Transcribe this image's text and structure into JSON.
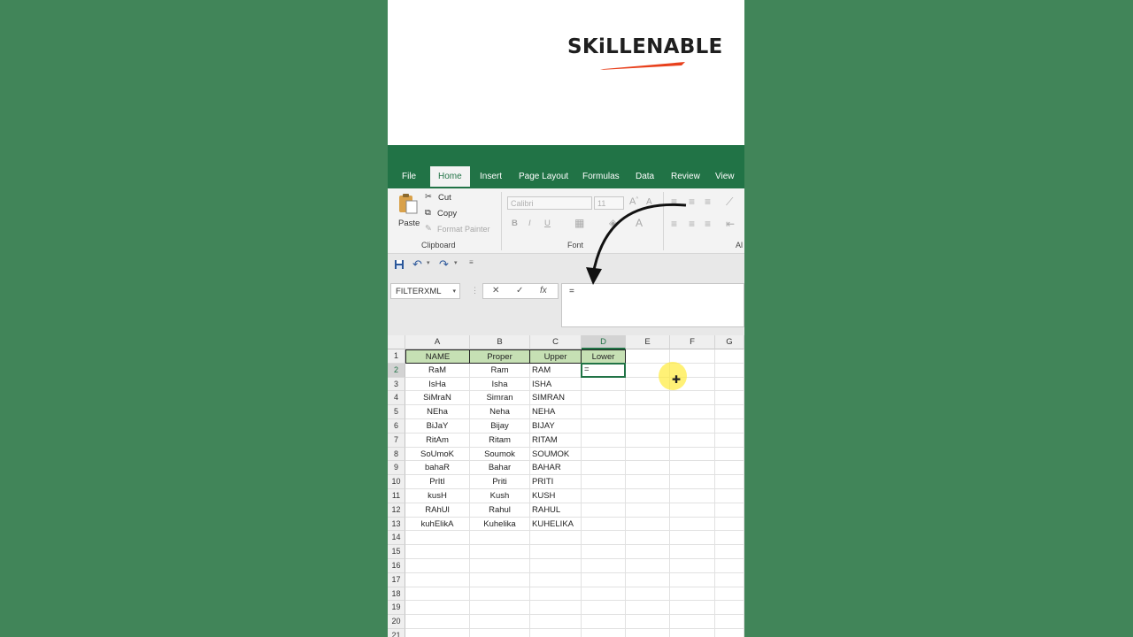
{
  "brand": {
    "logo_text": "SKiLLENABLE",
    "accent_color": "#e8401c"
  },
  "ribbon_tabs": [
    "File",
    "Home",
    "Insert",
    "Page Layout",
    "Formulas",
    "Data",
    "Review",
    "View"
  ],
  "active_tab": "Home",
  "clipboard": {
    "paste": "Paste",
    "cut": "Cut",
    "copy": "Copy",
    "format_painter": "Format Painter",
    "group_label": "Clipboard"
  },
  "font_group": {
    "font_name": "Calibri",
    "font_size": "11",
    "bold": "B",
    "italic": "I",
    "underline": "U",
    "group_label": "Font"
  },
  "alignment_group": {
    "group_label": "Al"
  },
  "formula_bar": {
    "name_box": "FILTERXML",
    "cancel": "✕",
    "enter": "✓",
    "fx": "fx",
    "content": "="
  },
  "columns": [
    "A",
    "B",
    "C",
    "D",
    "E",
    "F",
    "G"
  ],
  "selected_column": "D",
  "selected_row": "2",
  "header_row": [
    "NAME",
    "Proper",
    "Upper",
    "Lower"
  ],
  "rows": [
    [
      "RaM",
      "Ram",
      "RAM"
    ],
    [
      "IsHa",
      "Isha",
      "ISHA"
    ],
    [
      "SiMraN",
      "Simran",
      "SIMRAN"
    ],
    [
      "NEha",
      "Neha",
      "NEHA"
    ],
    [
      "BiJaY",
      "Bijay",
      "BIJAY"
    ],
    [
      "RitAm",
      "Ritam",
      "RITAM"
    ],
    [
      "SoUmoK",
      "Soumok",
      "SOUMOK"
    ],
    [
      "bahaR",
      "Bahar",
      "BAHAR"
    ],
    [
      "PrItI",
      "Priti",
      "PRITI"
    ],
    [
      "kusH",
      "Kush",
      "KUSH"
    ],
    [
      "RAhUl",
      "Rahul",
      "RAHUL"
    ],
    [
      "kuhElikA",
      "Kuhelika",
      "KUHELIKA"
    ]
  ],
  "row_numbers": [
    "1",
    "2",
    "3",
    "4",
    "5",
    "6",
    "7",
    "8",
    "9",
    "10",
    "11",
    "12",
    "13",
    "14",
    "15",
    "16",
    "17",
    "18",
    "19",
    "20",
    "21"
  ],
  "active_cell_value": "=",
  "colors": {
    "excel_green": "#217346",
    "background": "#418559",
    "header_fill": "#c6e0b4"
  }
}
